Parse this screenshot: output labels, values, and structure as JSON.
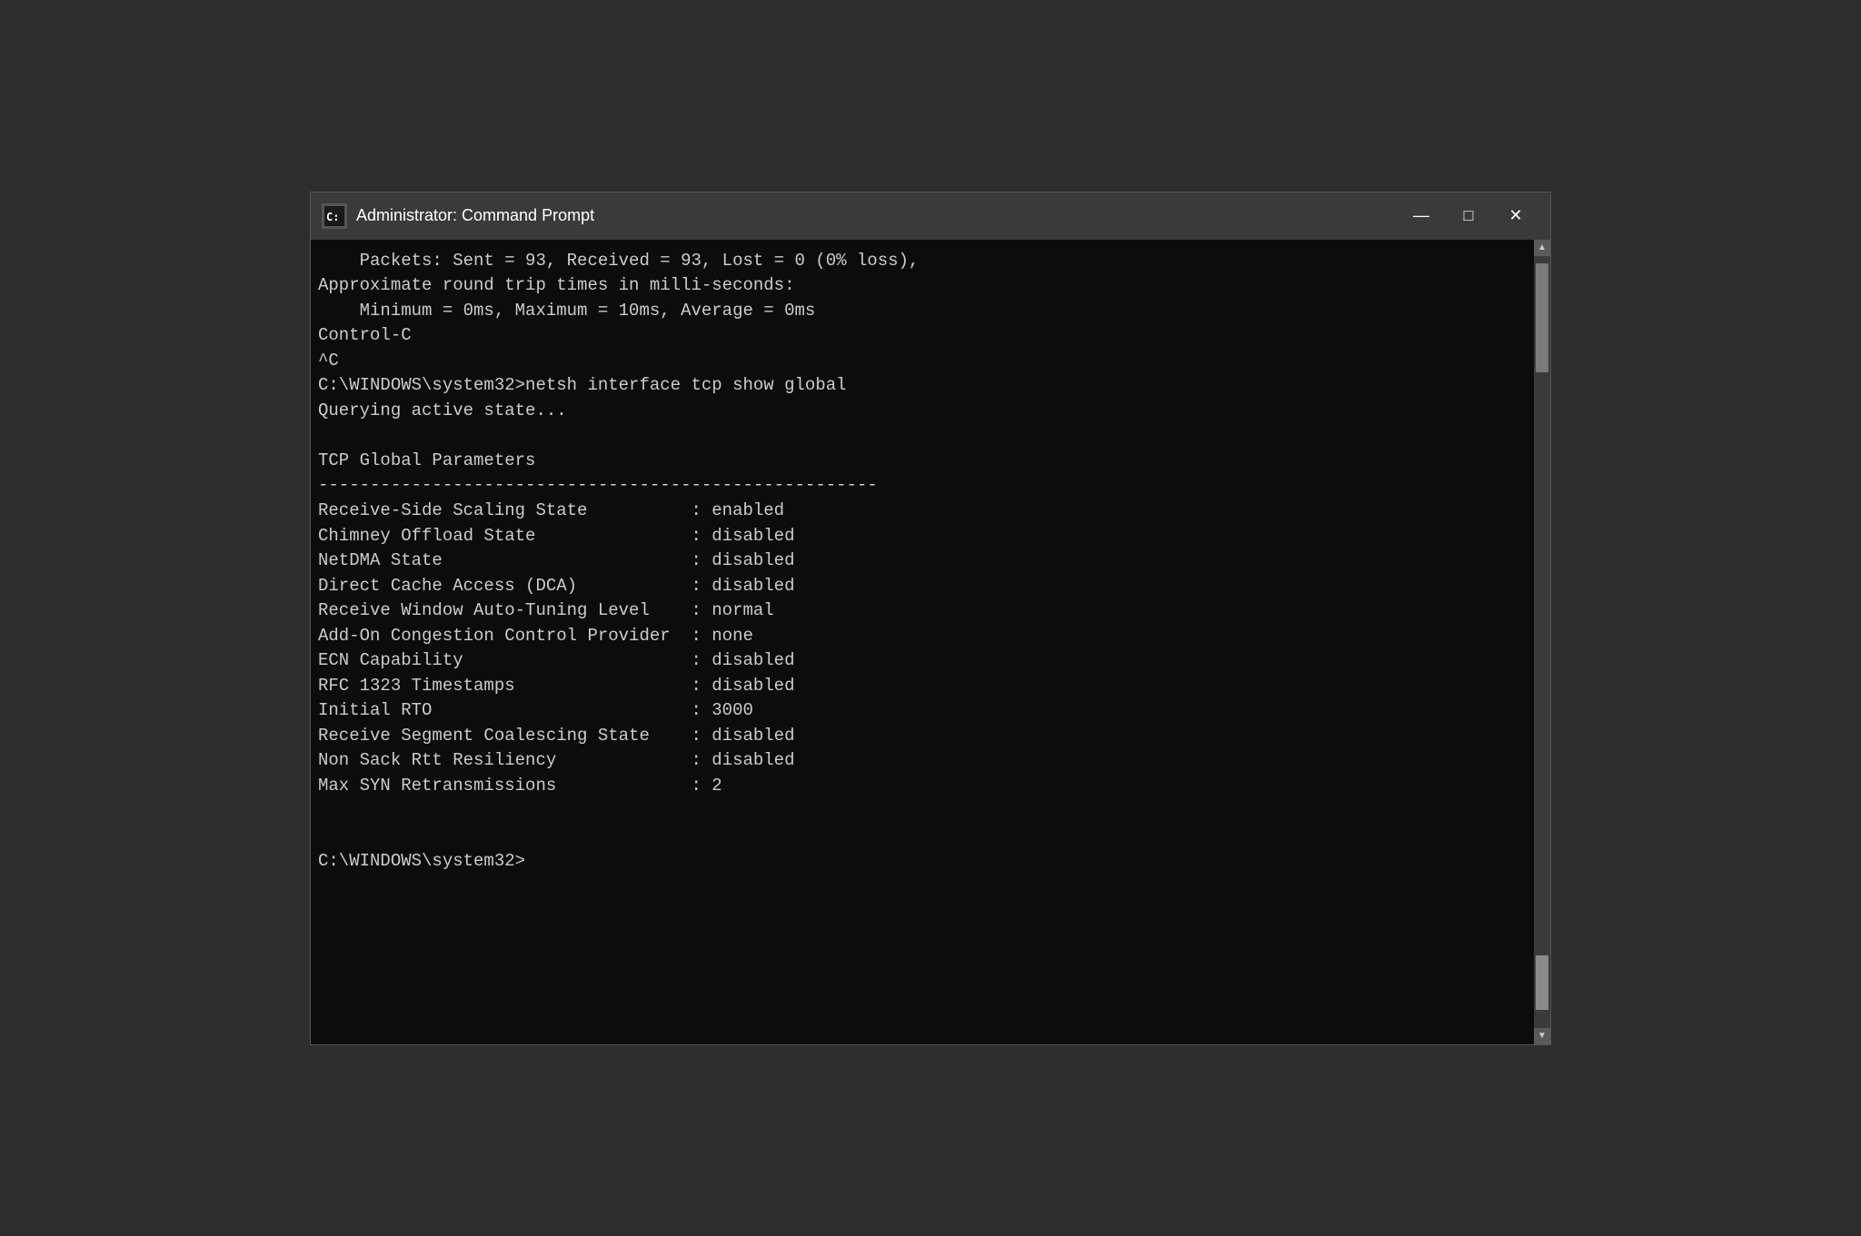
{
  "window": {
    "title": "Administrator: Command Prompt",
    "icon_label": "C:",
    "minimize_label": "—",
    "maximize_label": "□",
    "close_label": "✕"
  },
  "terminal": {
    "line1": "    Packets: Sent = 93, Received = 93, Lost = 0 (0% loss),",
    "line2": "Approximate round trip times in milli-seconds:",
    "line3": "    Minimum = 0ms, Maximum = 10ms, Average = 0ms",
    "line4": "Control-C",
    "line5": "^C",
    "line6": "C:\\WINDOWS\\system32>netsh interface tcp show global",
    "line7": "Querying active state...",
    "line8": "",
    "line9": "TCP Global Parameters",
    "line10": "------------------------------------------------------",
    "line11": "Receive-Side Scaling State          : enabled",
    "line12": "Chimney Offload State               : disabled",
    "line13": "NetDMA State                        : disabled",
    "line14": "Direct Cache Access (DCA)           : disabled",
    "line15": "Receive Window Auto-Tuning Level    : normal",
    "line16": "Add-On Congestion Control Provider  : none",
    "line17": "ECN Capability                      : disabled",
    "line18": "RFC 1323 Timestamps                 : disabled",
    "line19": "Initial RTO                         : 3000",
    "line20": "Receive Segment Coalescing State    : disabled",
    "line21": "Non Sack Rtt Resiliency             : disabled",
    "line22": "Max SYN Retransmissions             : 2",
    "line23": "",
    "line24": "",
    "line25": "C:\\WINDOWS\\system32>"
  }
}
